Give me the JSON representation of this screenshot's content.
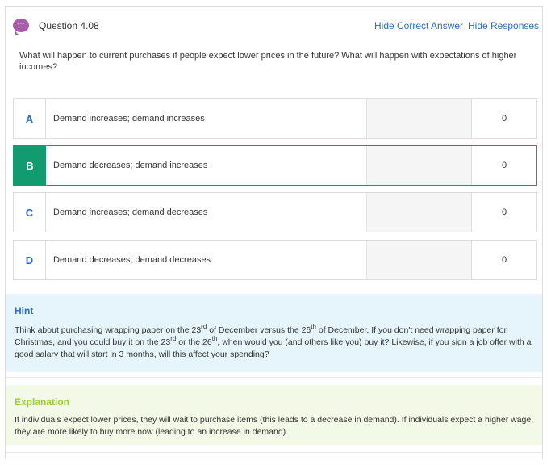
{
  "header": {
    "question_number": "Question 4.08",
    "icon": "speech-bubble-icon",
    "icon_glyph": "···",
    "hide_correct_answer": "Hide Correct Answer",
    "hide_responses": "Hide Responses"
  },
  "question": {
    "text": "What will happen to current purchases if people expect lower prices in the future? What will happen with expectations of higher incomes?"
  },
  "options": [
    {
      "letter": "A",
      "text": "Demand increases; demand increases",
      "count": "0",
      "correct": false
    },
    {
      "letter": "B",
      "text": "Demand decreases; demand increases",
      "count": "0",
      "correct": true
    },
    {
      "letter": "C",
      "text": "Demand increases; demand decreases",
      "count": "0",
      "correct": false
    },
    {
      "letter": "D",
      "text": "Demand decreases; demand decreases",
      "count": "0",
      "correct": false
    }
  ],
  "hint": {
    "title": "Hint",
    "p1": "Think about purchasing wrapping paper on the 23",
    "sup1": "rd",
    "p2": " of December versus the 26",
    "sup2": "th",
    "p3": " of December. If you don't need wrapping paper for Christmas, and you could buy it on the 23",
    "sup3": "rd",
    "p4": " or the 26",
    "sup4": "th",
    "p5": ", when would you (and others like you) buy it? Likewise, if you sign a job offer with a good salary that will start in 3 months, will this affect your spending?"
  },
  "explanation": {
    "title": "Explanation",
    "text": "If individuals expect lower prices, they will wait to purchase items (this leads to a decrease in demand). If individuals expect a higher wage, they are more likely to buy more now (leading to an increase in demand)."
  },
  "colors": {
    "accent_blue": "#2a6ebb",
    "correct_green": "#119b6e",
    "question_icon_purple": "#a85ca8",
    "hint_bg": "#e6f5fb",
    "explanation_bg": "#f2f9e6",
    "explanation_title": "#9ccc3c"
  }
}
